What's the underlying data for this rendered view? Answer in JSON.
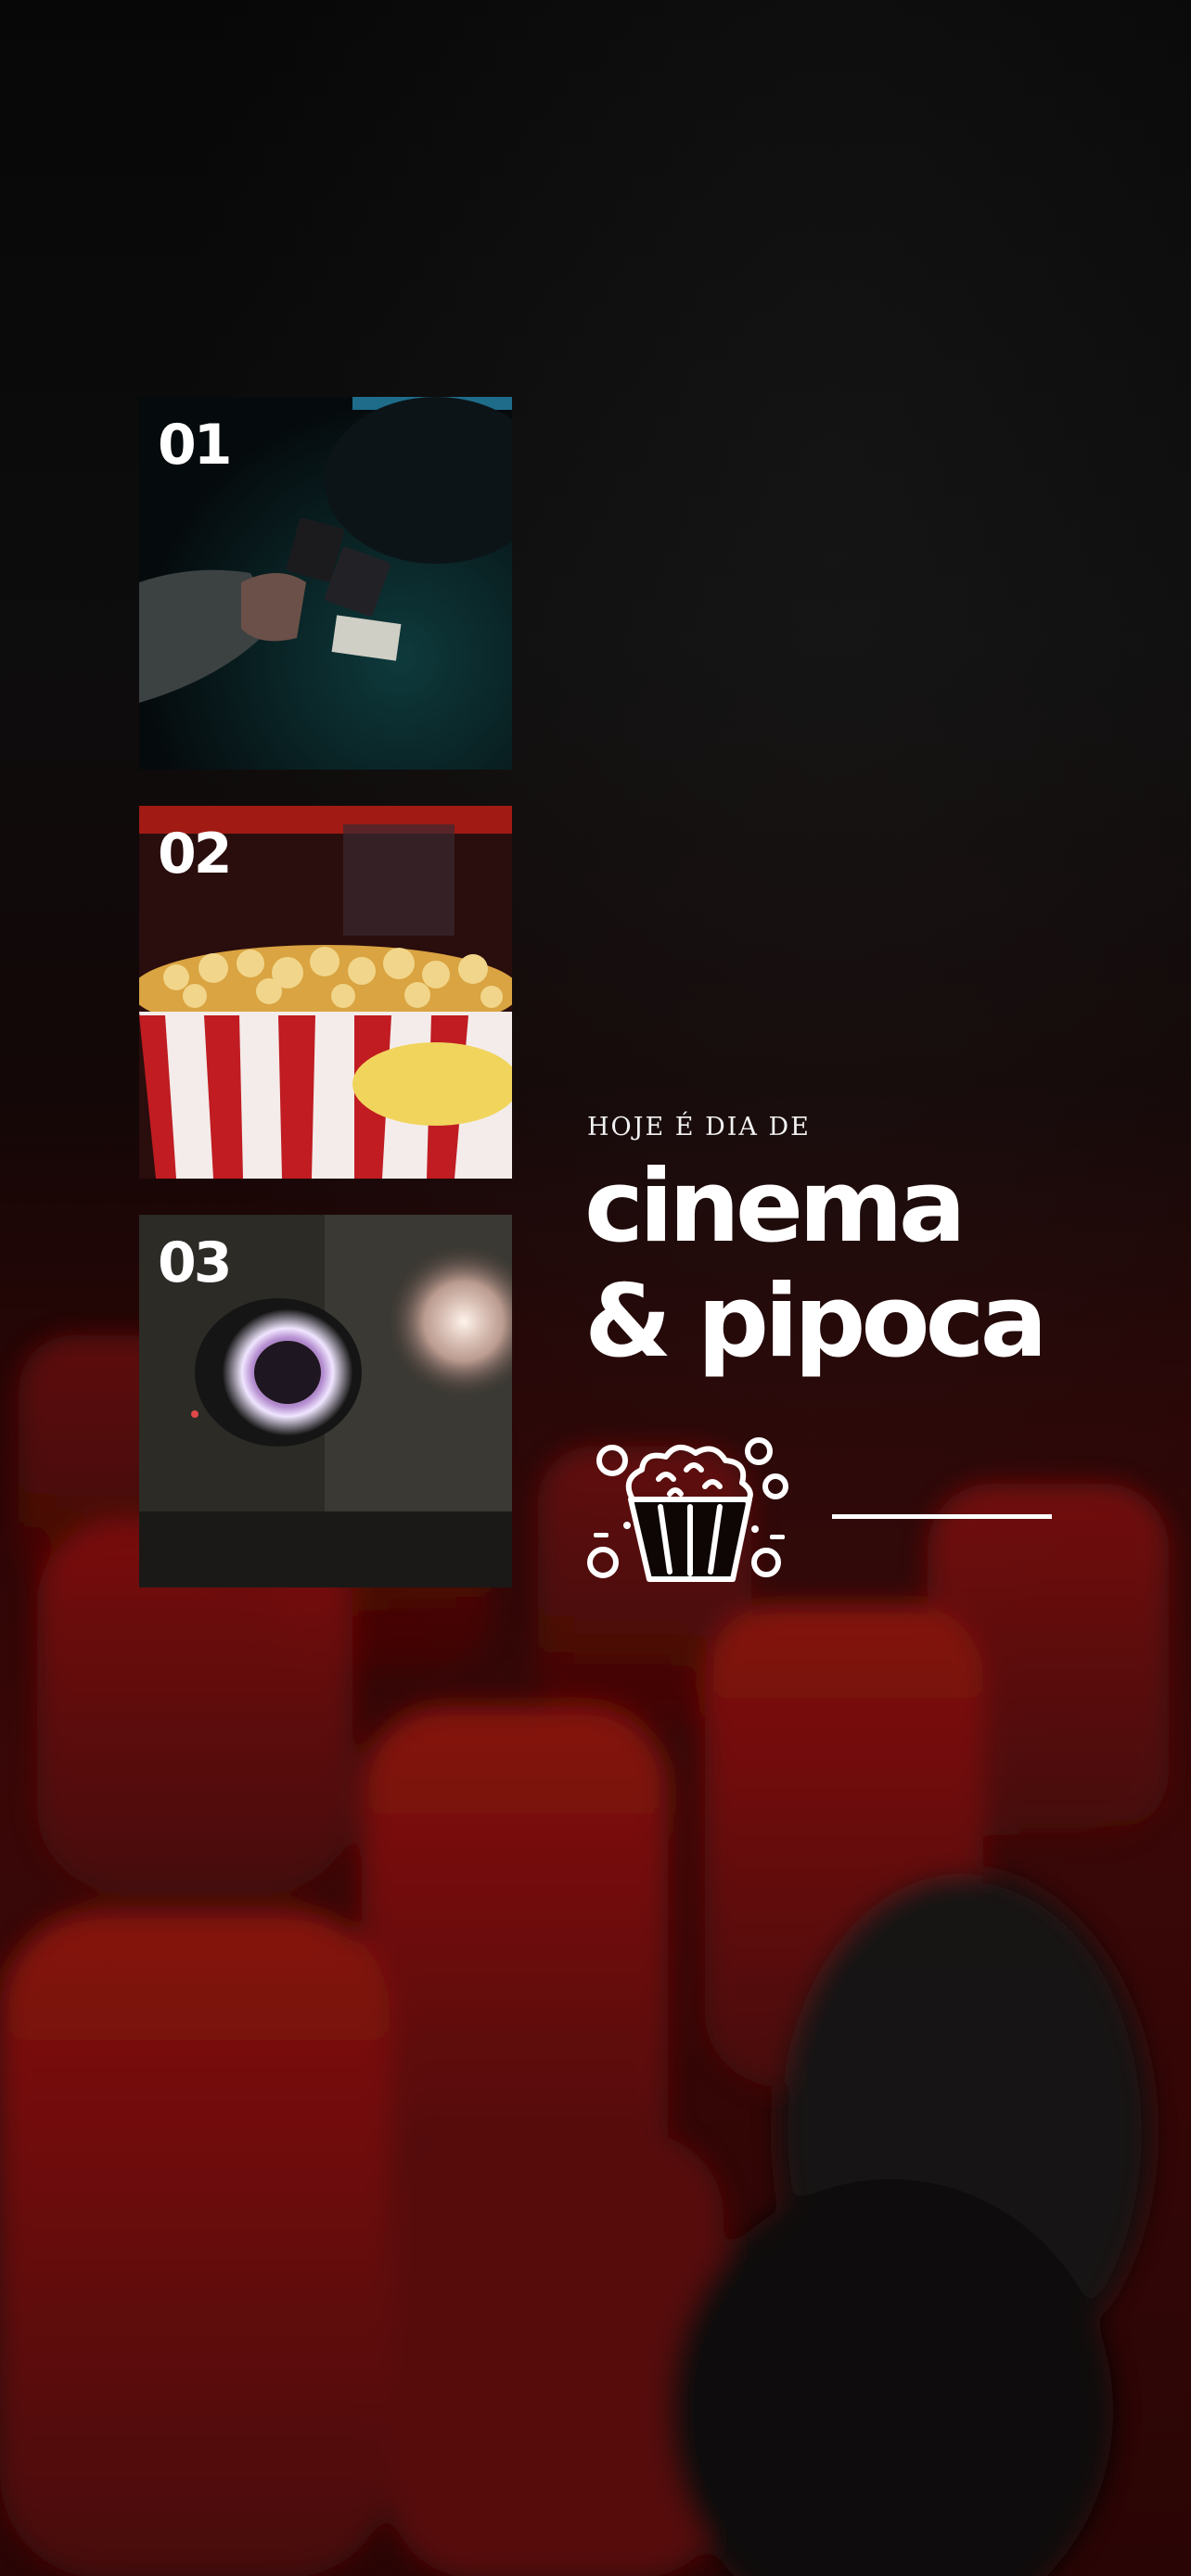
{
  "steps": [
    {
      "number": "01",
      "image": "cinema-tickets-photo"
    },
    {
      "number": "02",
      "image": "popcorn-bucket-photo"
    },
    {
      "number": "03",
      "image": "film-projector-photo"
    }
  ],
  "headline": {
    "kicker": "HOJE É DIA DE",
    "line1": "cinema",
    "line2": "& pipoca"
  },
  "icons": {
    "popcorn": "popcorn-bucket-icon"
  },
  "colors": {
    "accent_red": "#b3201e",
    "text": "#ffffff"
  }
}
